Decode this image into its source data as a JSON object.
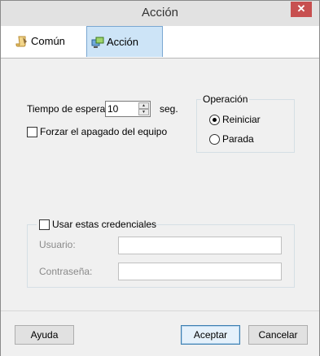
{
  "window": {
    "title": "Acción",
    "close_glyph": "✕"
  },
  "tabs": [
    {
      "label": "Común",
      "icon": "scroll-icon",
      "selected": false
    },
    {
      "label": "Acción",
      "icon": "network-action-icon",
      "selected": true
    }
  ],
  "timeout": {
    "label": "Tiempo de espera:",
    "value": "10",
    "unit": "seg."
  },
  "force_shutdown": {
    "label": "Forzar el apagado del equipo",
    "checked": false
  },
  "operation": {
    "legend": "Operación",
    "options": [
      {
        "label": "Reiniciar",
        "selected": true
      },
      {
        "label": "Parada",
        "selected": false
      }
    ]
  },
  "credentials": {
    "checkbox_label": "Usar estas credenciales",
    "checked": false,
    "username_label": "Usuario:",
    "username_value": "",
    "password_label": "Contraseña:",
    "password_value": ""
  },
  "buttons": {
    "help": "Ayuda",
    "accept": "Aceptar",
    "cancel": "Cancelar"
  }
}
